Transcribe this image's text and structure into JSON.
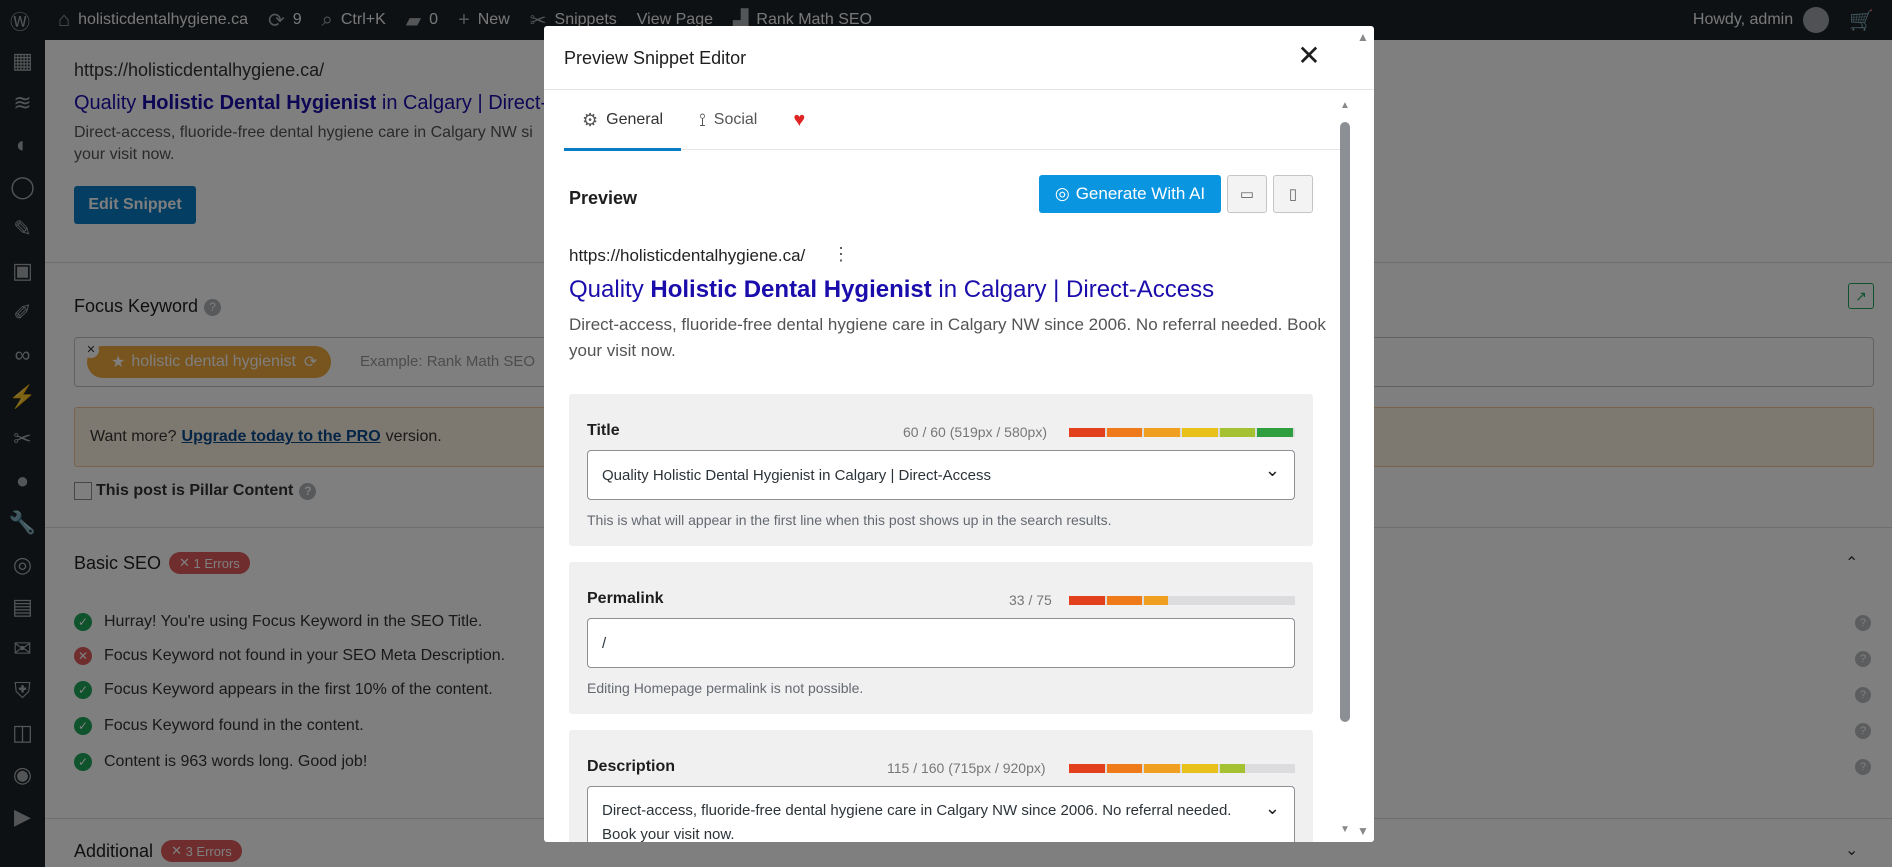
{
  "adminbar": {
    "site_name": "holisticdentalhygiene.ca",
    "updates_count": "9",
    "search_shortcut": "Ctrl+K",
    "comments_count": "0",
    "new_label": "New",
    "snippets_label": "Snippets",
    "view_page_label": "View Page",
    "rankmath_label": "Rank Math SEO",
    "howdy": "Howdy, admin"
  },
  "background": {
    "url": "https://holisticdentalhygiene.ca/",
    "title_pre": "Quality ",
    "title_bold": "Holistic Dental Hygienist",
    "title_post": " in Calgary | Direct-",
    "desc": "Direct-access, fluoride-free dental hygiene care in Calgary NW si",
    "desc2": "your visit now.",
    "edit_snippet": "Edit Snippet",
    "focus_keyword_label": "Focus Keyword",
    "keyword_tag": "holistic dental hygienist",
    "keyword_placeholder": "Example: Rank Math SEO",
    "upgrade_pre": "Want more?",
    "upgrade_link": "Upgrade today to the PRO",
    "upgrade_post": "version.",
    "pillar_label": "This post is Pillar Content",
    "basic_seo": "Basic SEO",
    "basic_errors": "1 Errors",
    "checks": [
      {
        "status": "ok",
        "text": "Hurray! You're using Focus Keyword in the SEO Title."
      },
      {
        "status": "bad",
        "text": "Focus Keyword not found in your SEO Meta Description."
      },
      {
        "status": "ok",
        "text": "Focus Keyword appears in the first 10% of the content."
      },
      {
        "status": "ok",
        "text": "Focus Keyword found in the content."
      },
      {
        "status": "ok",
        "text": "Content is 963 words long. Good job!"
      }
    ],
    "additional": "Additional",
    "additional_errors": "3 Errors"
  },
  "modal": {
    "title": "Preview Snippet Editor",
    "tabs": [
      {
        "label": "General",
        "icon": "gear-icon"
      },
      {
        "label": "Social",
        "icon": "share-icon"
      },
      {
        "label": "",
        "icon": "heart-icon"
      }
    ],
    "preview_label": "Preview",
    "generate_ai": "Generate With AI",
    "preview": {
      "url": "https://holisticdentalhygiene.ca/",
      "title_pre": "Quality ",
      "title_bold": "Holistic Dental Hygienist",
      "title_post": " in Calgary | Direct-Access",
      "desc": "Direct-access, fluoride-free dental hygiene care in Calgary NW since 2006. No referral needed. Book your visit now."
    },
    "fields": {
      "title": {
        "label": "Title",
        "count": "60 / 60 (519px / 580px)",
        "value": "Quality Holistic Dental Hygienist in Calgary | Direct-Access",
        "hint": "This is what will appear in the first line when this post shows up in the search results.",
        "fill": 1.0
      },
      "permalink": {
        "label": "Permalink",
        "count": "33 / 75",
        "value": "/",
        "hint": "Editing Homepage permalink is not possible.",
        "fill": 0.44
      },
      "description": {
        "label": "Description",
        "count": "115 / 160 (715px / 920px)",
        "value": "Direct-access, fluoride-free dental hygiene care in Calgary NW since 2006. No referral needed. Book your visit now.",
        "fill": 0.78
      }
    }
  },
  "colors": {
    "accent": "#0a7cc7",
    "link": "#1a0dab",
    "ok": "#1fa65b",
    "error": "#e05a5a",
    "keyword": "#f0a83c"
  }
}
